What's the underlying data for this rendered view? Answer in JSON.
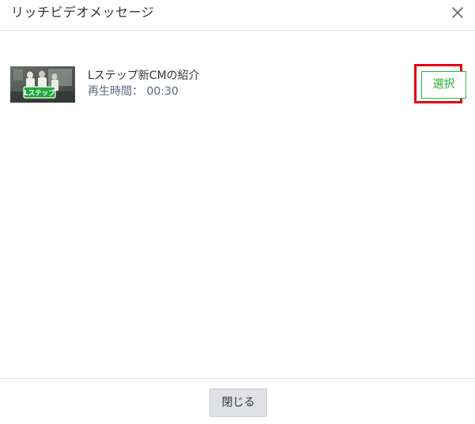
{
  "header": {
    "title": "リッチビデオメッセージ",
    "close_icon": "close-icon"
  },
  "videos": [
    {
      "thumbnail_logo": "Lステップ",
      "title": "Lステップ新CMの紹介",
      "duration_label": "再生時間： 00:30",
      "select_label": "選択"
    }
  ],
  "footer": {
    "close_label": "閉じる"
  },
  "colors": {
    "select_green": "#1fae2e",
    "highlight_red": "#e60012",
    "close_button_bg": "#dfe1e4"
  }
}
